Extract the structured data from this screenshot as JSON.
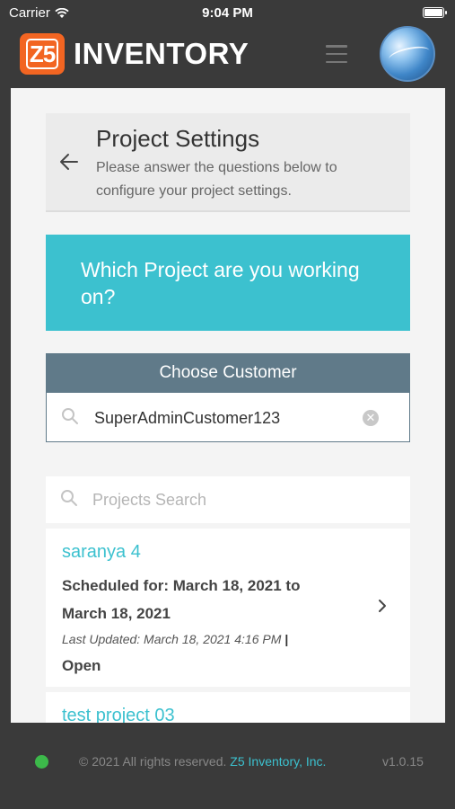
{
  "status_bar": {
    "carrier": "Carrier",
    "time": "9:04 PM"
  },
  "header": {
    "logo_mark": "Z5",
    "logo_text": "INVENTORY",
    "menu_icon": "hamburger-icon",
    "avatar": "user-avatar"
  },
  "settings": {
    "title": "Project Settings",
    "description": "Please answer the questions below to configure your project settings.",
    "back_icon": "arrow-left-icon"
  },
  "question": {
    "text": "Which Project are you working on?"
  },
  "customer": {
    "header": "Choose Customer",
    "value": "SuperAdminCustomer123",
    "clear_icon": "clear-icon"
  },
  "projects_search": {
    "placeholder": "Projects Search"
  },
  "projects": [
    {
      "name": "saranya 4",
      "scheduled": "Scheduled for: March 18, 2021 to March 18, 2021",
      "updated": "Last Updated: March 18, 2021 4:16 PM",
      "separator": "|",
      "status": "Open"
    },
    {
      "name": "test project 03"
    }
  ],
  "footer": {
    "copyright": "© 2021 All rights reserved.",
    "company": "Z5 Inventory, Inc.",
    "version": "v1.0.15"
  },
  "colors": {
    "accent": "#3cc1cf",
    "brand_orange": "#f26522",
    "customer_header": "#607a89",
    "status_online": "#3cb94a",
    "background": "#3a3a3a"
  }
}
